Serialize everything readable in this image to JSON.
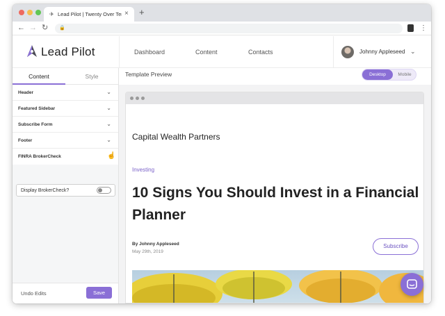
{
  "browser": {
    "tab_title": "Lead Pilot | Twenty Over Ten",
    "tab_favicon": "compass-icon",
    "tab_close": "×",
    "new_tab": "+",
    "lock_icon": "lock-icon"
  },
  "header": {
    "brand": "Lead Pilot",
    "nav": [
      "Dashboard",
      "Content",
      "Contacts"
    ],
    "user": "Johnny Appleseed"
  },
  "sidebar": {
    "tabs": [
      "Content",
      "Style"
    ],
    "sections": [
      "Header",
      "Featured Sidebar",
      "Subscribe Form",
      "Footer",
      "FINRA BrokerCheck"
    ],
    "toggle_label": "Display BrokerCheck?",
    "toggle_on": false,
    "undo_label": "Undo Edits",
    "save_label": "Save"
  },
  "preview": {
    "title": "Template Preview",
    "modes": [
      "Desktop",
      "Mobile"
    ],
    "active_mode": "Desktop"
  },
  "page": {
    "site_name": "Capital Wealth Partners",
    "category": "Investing",
    "headline": "10 Signs You Should Invest in a Financial Planner",
    "author": "By Johnny Appleseed",
    "date": "May 29th, 2019",
    "subscribe_label": "Subscribe"
  },
  "colors": {
    "accent": "#8a6fd6",
    "accent_dark": "#6b52c0"
  }
}
